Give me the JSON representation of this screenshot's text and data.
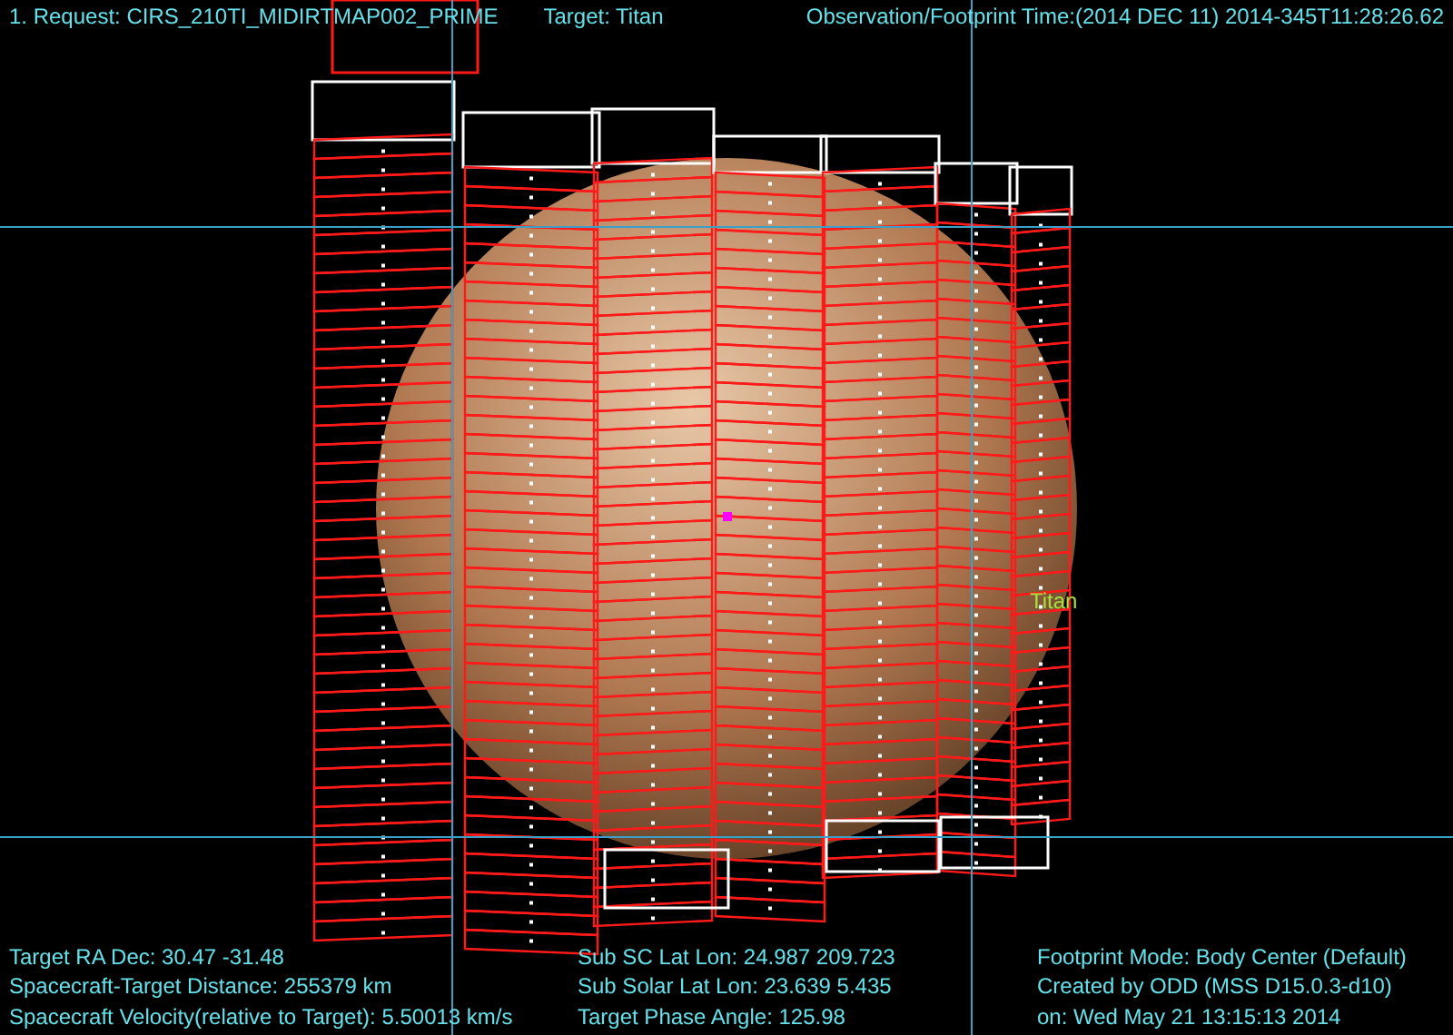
{
  "header": {
    "request": "1. Request: CIRS_210TI_MIDIRTMAP002_PRIME",
    "target": "Target: Titan",
    "time": "Observation/Footprint Time:(2014 DEC 11) 2014-345T11:28:26.62"
  },
  "body_label": "Titan",
  "info_columns": [
    [
      "Target RA Dec: 30.47  -31.48",
      "Spacecraft-Target Distance:  255379 km",
      "Spacecraft Velocity(relative to Target): 5.50013 km/s"
    ],
    [
      "Sub SC Lat Lon: 24.987  209.723",
      "Sub Solar Lat Lon: 23.639   5.435",
      "Target Phase Angle: 125.98"
    ],
    [
      "Footprint Mode: Body Center (Default)",
      "Created by ODD (MSS D15.0.3-d10)",
      "on: Wed May 21 13:15:13 2014"
    ]
  ]
}
